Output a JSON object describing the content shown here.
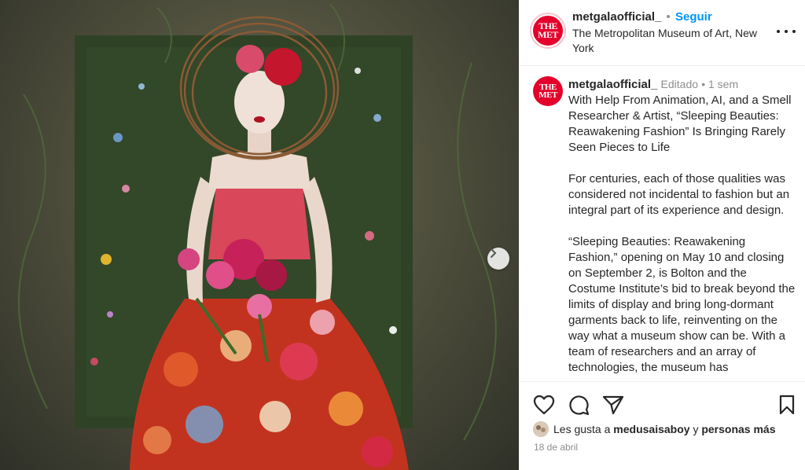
{
  "post": {
    "username": "metgalaofficial_",
    "follow_label": "Seguir",
    "location": "The Metropolitan Museum of Art, New York",
    "avatar_text": "THE MET"
  },
  "caption": {
    "username": "metgalaofficial_",
    "edited": "Editado",
    "time": "1 sem",
    "paragraphs": [
      "With Help From Animation, AI, and a Smell Researcher & Artist, “Sleeping Beauties: Reawakening Fashion” Is Bringing Rarely Seen Pieces to Life",
      "For centuries, each of those qualities was considered not incidental to fashion but an integral part of its experience and design.",
      "“Sleeping Beauties: Reawakening Fashion,” opening on May 10 and closing on September 2, is Bolton and the Costume Institute’s bid to break beyond the limits of display and bring long-dormant garments back to life, reinventing on the way what a museum show can be. With a team of researchers and an array of technologies, the museum has"
    ]
  },
  "likes": {
    "prefix": "Les gusta a",
    "user": "medusaisaboy",
    "conj": "y",
    "others": "personas más"
  },
  "date": "18 de abril",
  "icons": [
    "heart-icon",
    "comment-icon",
    "share-icon",
    "bookmark-icon",
    "more-options-icon",
    "chevron-right-icon"
  ],
  "colors": {
    "follow": "#0095f6",
    "met_red": "#e4002b"
  }
}
